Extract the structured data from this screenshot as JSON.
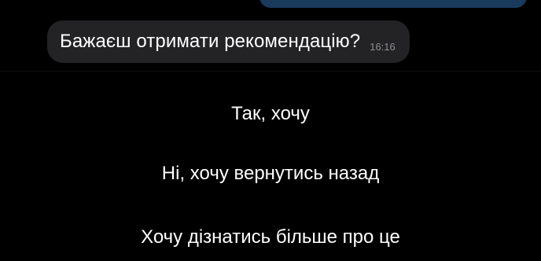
{
  "chat": {
    "message": {
      "text": "Бажаєш отримати рекомендацію?",
      "time": "16:16"
    }
  },
  "reply_keyboard": {
    "options": [
      {
        "label": "Так, хочу"
      },
      {
        "label": "Ні, хочу вернутись назад"
      },
      {
        "label": "Хочу дізнатись більше про це"
      }
    ]
  },
  "colors": {
    "background": "#000000",
    "bubble": "#232325",
    "text": "#ffffff",
    "timestamp": "#8e8e93",
    "outgoing_bubble": "#2f6aa8"
  }
}
